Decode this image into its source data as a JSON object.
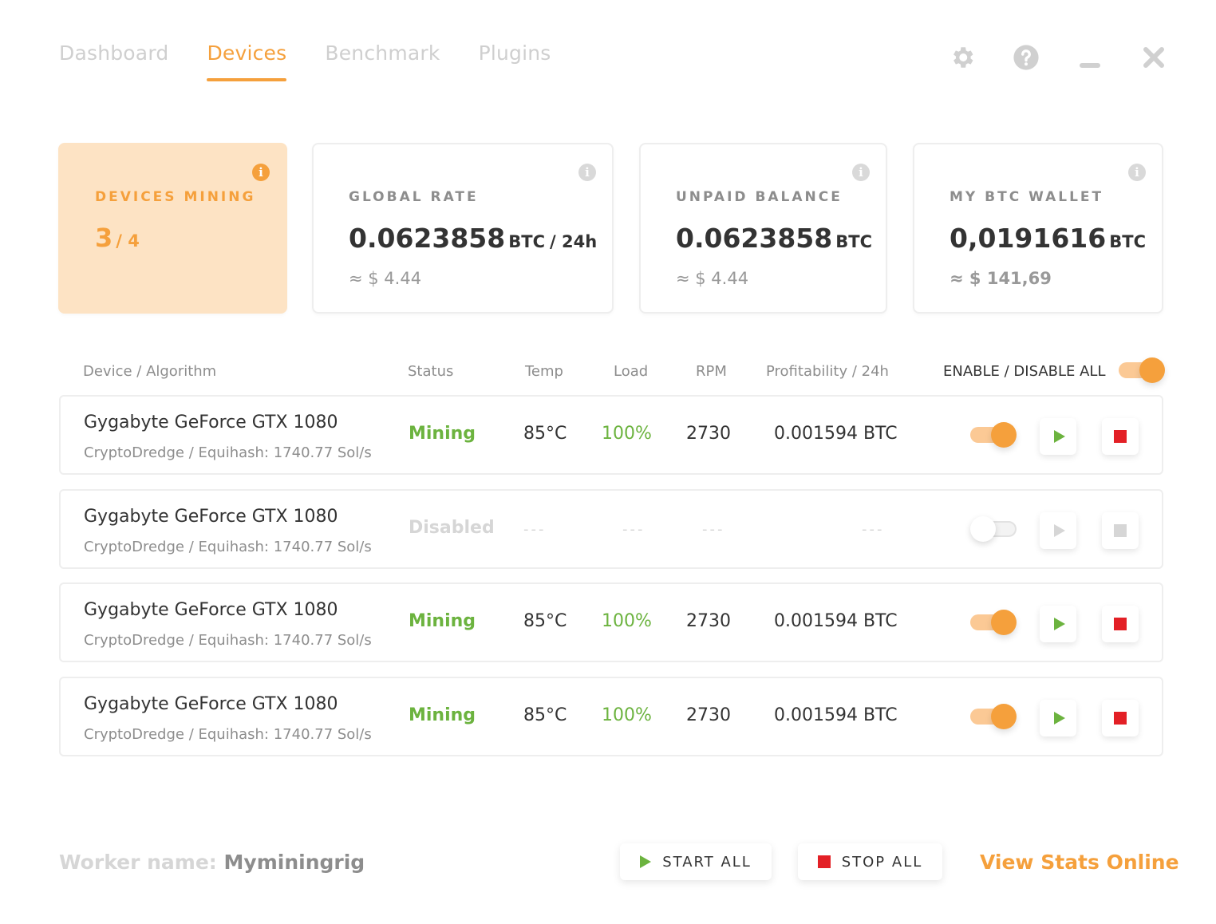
{
  "nav": {
    "tabs": [
      {
        "label": "Dashboard",
        "active": false
      },
      {
        "label": "Devices",
        "active": true
      },
      {
        "label": "Benchmark",
        "active": false
      },
      {
        "label": "Plugins",
        "active": false
      }
    ],
    "controls": [
      "gear-icon",
      "help-icon",
      "minimize-icon",
      "close-icon"
    ]
  },
  "colors": {
    "accent": "#f5a03c",
    "accent_light": "#fde3c4",
    "success": "#6cb33f",
    "danger": "#e32026",
    "muted": "#8d8d8d",
    "disabled": "#d6d6d6"
  },
  "cards": {
    "devices_mining": {
      "label": "DEVICES MINING",
      "active": "3",
      "total": "/ 4"
    },
    "global_rate": {
      "label": "GLOBAL RATE",
      "value": "0.0623858",
      "unit": "BTC",
      "per": "/ 24h",
      "usd": "≈ $ 4.44"
    },
    "unpaid_balance": {
      "label": "UNPAID BALANCE",
      "value": "0.0623858",
      "unit": "BTC",
      "usd": "≈ $ 4.44"
    },
    "wallet": {
      "label": "MY BTC WALLET",
      "value": "0,0191616",
      "unit": "BTC",
      "usd": "≈ $ 141,69"
    }
  },
  "table": {
    "headers": {
      "device": "Device / Algorithm",
      "status": "Status",
      "temp": "Temp",
      "load": "Load",
      "rpm": "RPM",
      "profit": "Profitability / 24h",
      "enable_all": "ENABLE / DISABLE ALL"
    },
    "enable_all_on": true,
    "rows": [
      {
        "name": "Gygabyte GeForce GTX 1080",
        "algo": "CryptoDredge / Equihash: 1740.77 Sol/s",
        "status": "Mining",
        "temp": "85°C",
        "load": "100%",
        "rpm": "2730",
        "profit": "0.001594 BTC",
        "enabled": true
      },
      {
        "name": "Gygabyte GeForce GTX 1080",
        "algo": "CryptoDredge / Equihash: 1740.77 Sol/s",
        "status": "Disabled",
        "temp": "---",
        "load": "---",
        "rpm": "---",
        "profit": "---",
        "enabled": false
      },
      {
        "name": "Gygabyte GeForce GTX 1080",
        "algo": "CryptoDredge / Equihash: 1740.77 Sol/s",
        "status": "Mining",
        "temp": "85°C",
        "load": "100%",
        "rpm": "2730",
        "profit": "0.001594 BTC",
        "enabled": true
      },
      {
        "name": "Gygabyte GeForce GTX 1080",
        "algo": "CryptoDredge / Equihash: 1740.77 Sol/s",
        "status": "Mining",
        "temp": "85°C",
        "load": "100%",
        "rpm": "2730",
        "profit": "0.001594 BTC",
        "enabled": true
      }
    ]
  },
  "footer": {
    "worker_label": "Worker name:",
    "worker_name": "Myminingrig",
    "start_all": "START ALL",
    "stop_all": "STOP ALL",
    "view_stats": "View Stats Online"
  }
}
